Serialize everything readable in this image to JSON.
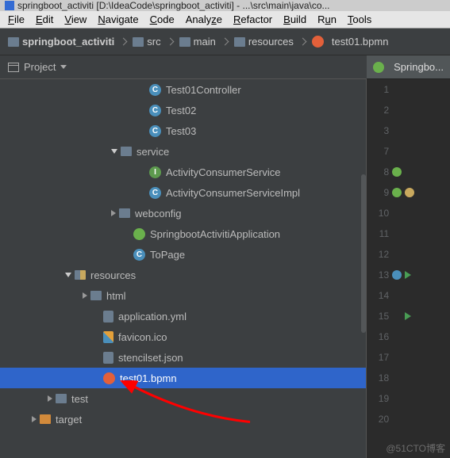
{
  "titlebar": "springboot_activiti [D:\\IdeaCode\\springboot_activiti] - ...\\src\\main\\java\\co...",
  "menu": [
    "File",
    "Edit",
    "View",
    "Navigate",
    "Code",
    "Analyze",
    "Refactor",
    "Build",
    "Run",
    "Tools"
  ],
  "breadcrumbs": {
    "project": "springboot_activiti",
    "b1": "src",
    "b2": "main",
    "b3": "resources",
    "b4": "test01.bpmn"
  },
  "toolbar": {
    "project": "Project"
  },
  "tree": {
    "t01ctrl": "Test01Controller",
    "t02": "Test02",
    "t03": "Test03",
    "service": "service",
    "acs": "ActivityConsumerService",
    "acsimpl": "ActivityConsumerServiceImpl",
    "webconfig": "webconfig",
    "springapp": "SpringbootActivitiApplication",
    "topage": "ToPage",
    "resources": "resources",
    "html": "html",
    "appyml": "application.yml",
    "favicon": "favicon.ico",
    "stencil": "stencilset.json",
    "test01": "test01.bpmn",
    "test": "test",
    "target": "target"
  },
  "editor": {
    "tab": "Springbo...",
    "lines": [
      1,
      2,
      3,
      7,
      8,
      9,
      10,
      11,
      12,
      13,
      14,
      15,
      16,
      17,
      18,
      19,
      20
    ]
  },
  "watermark": "@51CTO博客"
}
